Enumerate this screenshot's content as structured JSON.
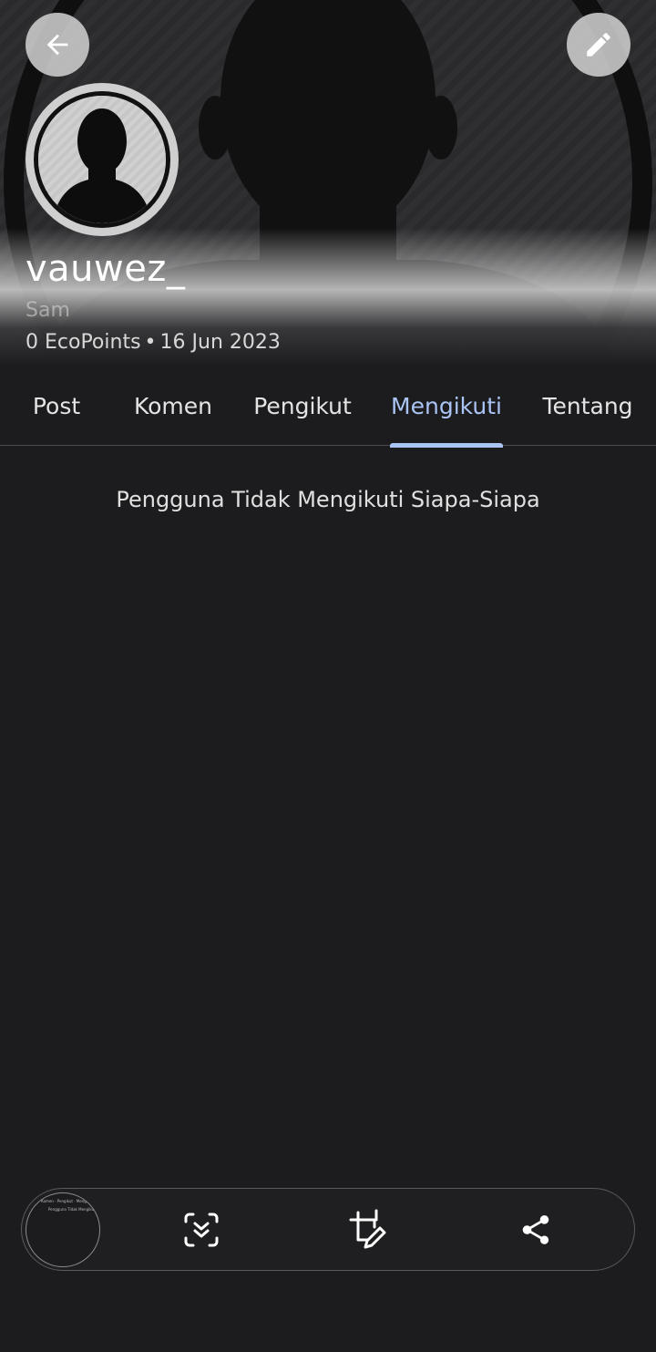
{
  "header": {
    "username": "vauwez_",
    "display_name": "Sam",
    "points": "0 EcoPoints",
    "separator": "•",
    "join_date": "16 Jun 2023",
    "back_icon": "arrow-left-icon",
    "edit_icon": "pencil-icon",
    "avatar_icon": "default-avatar-silhouette"
  },
  "tabs": [
    {
      "label": "Post",
      "active": false
    },
    {
      "label": "Komen",
      "active": false
    },
    {
      "label": "Pengikut",
      "active": false
    },
    {
      "label": "Mengikuti",
      "active": true
    },
    {
      "label": "Tentang",
      "active": false
    }
  ],
  "content": {
    "empty_message": "Pengguna Tidak Mengikuti Siapa-Siapa"
  },
  "screenshot_toolbar": {
    "preview_icon": "screenshot-preview-thumbnail",
    "scroll_capture_icon": "scroll-capture-icon",
    "crop_edit_icon": "crop-edit-icon",
    "share_icon": "share-icon"
  },
  "colors": {
    "background": "#1c1c1e",
    "accent": "#a9c4f5",
    "text": "#e4e4e4",
    "divider": "#4a4a4d"
  }
}
